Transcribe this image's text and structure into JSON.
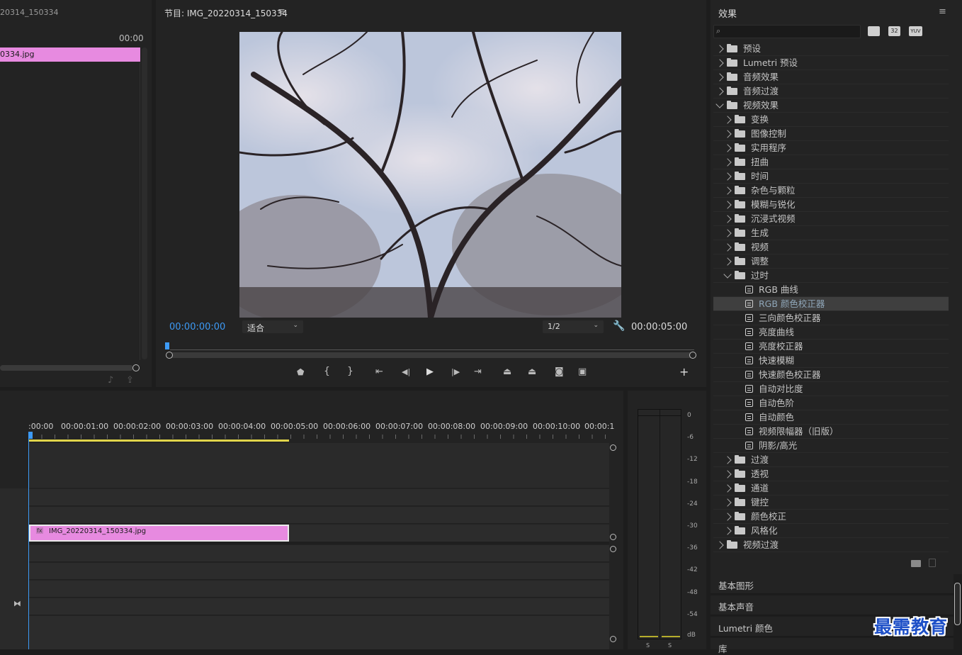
{
  "source": {
    "title": "20314_150334",
    "timecode": "00:00",
    "clip_name": "0334.jpg"
  },
  "program": {
    "title": "节目: IMG_20220314_150334",
    "timecode_current": "00:00:00:00",
    "timecode_duration": "00:00:05:00",
    "fit_select": "适合",
    "resolution_select": "1/2"
  },
  "timeline": {
    "ruler_labels": [
      ":00:00",
      "00:00:01:00",
      "00:00:02:00",
      "00:00:03:00",
      "00:00:04:00",
      "00:00:05:00",
      "00:00:06:00",
      "00:00:07:00",
      "00:00:08:00",
      "00:00:09:00",
      "00:00:10:00",
      "00:00:1"
    ],
    "clip_name": "IMG_20220314_150334.jpg",
    "clip_fx": "fx"
  },
  "meter": {
    "labels": [
      "0",
      "-6",
      "-12",
      "-18",
      "-24",
      "-30",
      "-36",
      "-42",
      "-48",
      "-54",
      "dB"
    ],
    "solo": [
      "S",
      "S"
    ]
  },
  "effects": {
    "title": "效果",
    "search_placeholder": "",
    "filter_badges": [
      "",
      "32",
      "YUV"
    ],
    "tree": [
      {
        "label": "预设",
        "level": 0,
        "kind": "preset"
      },
      {
        "label": "Lumetri 预设",
        "level": 0,
        "kind": "preset"
      },
      {
        "label": "音频效果",
        "level": 0,
        "kind": "folder"
      },
      {
        "label": "音频过渡",
        "level": 0,
        "kind": "folder"
      },
      {
        "label": "视频效果",
        "level": 0,
        "kind": "folder",
        "open": true
      },
      {
        "label": "变换",
        "level": 1,
        "kind": "folder"
      },
      {
        "label": "图像控制",
        "level": 1,
        "kind": "folder"
      },
      {
        "label": "实用程序",
        "level": 1,
        "kind": "folder"
      },
      {
        "label": "扭曲",
        "level": 1,
        "kind": "folder"
      },
      {
        "label": "时间",
        "level": 1,
        "kind": "folder"
      },
      {
        "label": "杂色与颗粒",
        "level": 1,
        "kind": "folder"
      },
      {
        "label": "模糊与锐化",
        "level": 1,
        "kind": "folder"
      },
      {
        "label": "沉浸式视频",
        "level": 1,
        "kind": "folder"
      },
      {
        "label": "生成",
        "level": 1,
        "kind": "folder"
      },
      {
        "label": "视频",
        "level": 1,
        "kind": "folder"
      },
      {
        "label": "调整",
        "level": 1,
        "kind": "folder"
      },
      {
        "label": "过时",
        "level": 1,
        "kind": "folder",
        "open": true
      },
      {
        "label": "RGB 曲线",
        "level": 2,
        "kind": "effect"
      },
      {
        "label": "RGB 颜色校正器",
        "level": 2,
        "kind": "effect",
        "selected": true
      },
      {
        "label": "三向颜色校正器",
        "level": 2,
        "kind": "effect"
      },
      {
        "label": "亮度曲线",
        "level": 2,
        "kind": "effect"
      },
      {
        "label": "亮度校正器",
        "level": 2,
        "kind": "effect"
      },
      {
        "label": "快速模糊",
        "level": 2,
        "kind": "effect"
      },
      {
        "label": "快速颜色校正器",
        "level": 2,
        "kind": "effect"
      },
      {
        "label": "自动对比度",
        "level": 2,
        "kind": "effect"
      },
      {
        "label": "自动色阶",
        "level": 2,
        "kind": "effect"
      },
      {
        "label": "自动颜色",
        "level": 2,
        "kind": "effect"
      },
      {
        "label": "视频限幅器（旧版）",
        "level": 2,
        "kind": "effect"
      },
      {
        "label": "阴影/高光",
        "level": 2,
        "kind": "effect"
      },
      {
        "label": "过渡",
        "level": 1,
        "kind": "folder"
      },
      {
        "label": "透视",
        "level": 1,
        "kind": "folder"
      },
      {
        "label": "通道",
        "level": 1,
        "kind": "folder"
      },
      {
        "label": "键控",
        "level": 1,
        "kind": "folder"
      },
      {
        "label": "颜色校正",
        "level": 1,
        "kind": "folder"
      },
      {
        "label": "风格化",
        "level": 1,
        "kind": "folder"
      },
      {
        "label": "视频过渡",
        "level": 0,
        "kind": "folder"
      }
    ]
  },
  "side_panels": [
    "基本图形",
    "基本声音",
    "Lumetri 颜色",
    "库"
  ],
  "watermark": "最需教育"
}
